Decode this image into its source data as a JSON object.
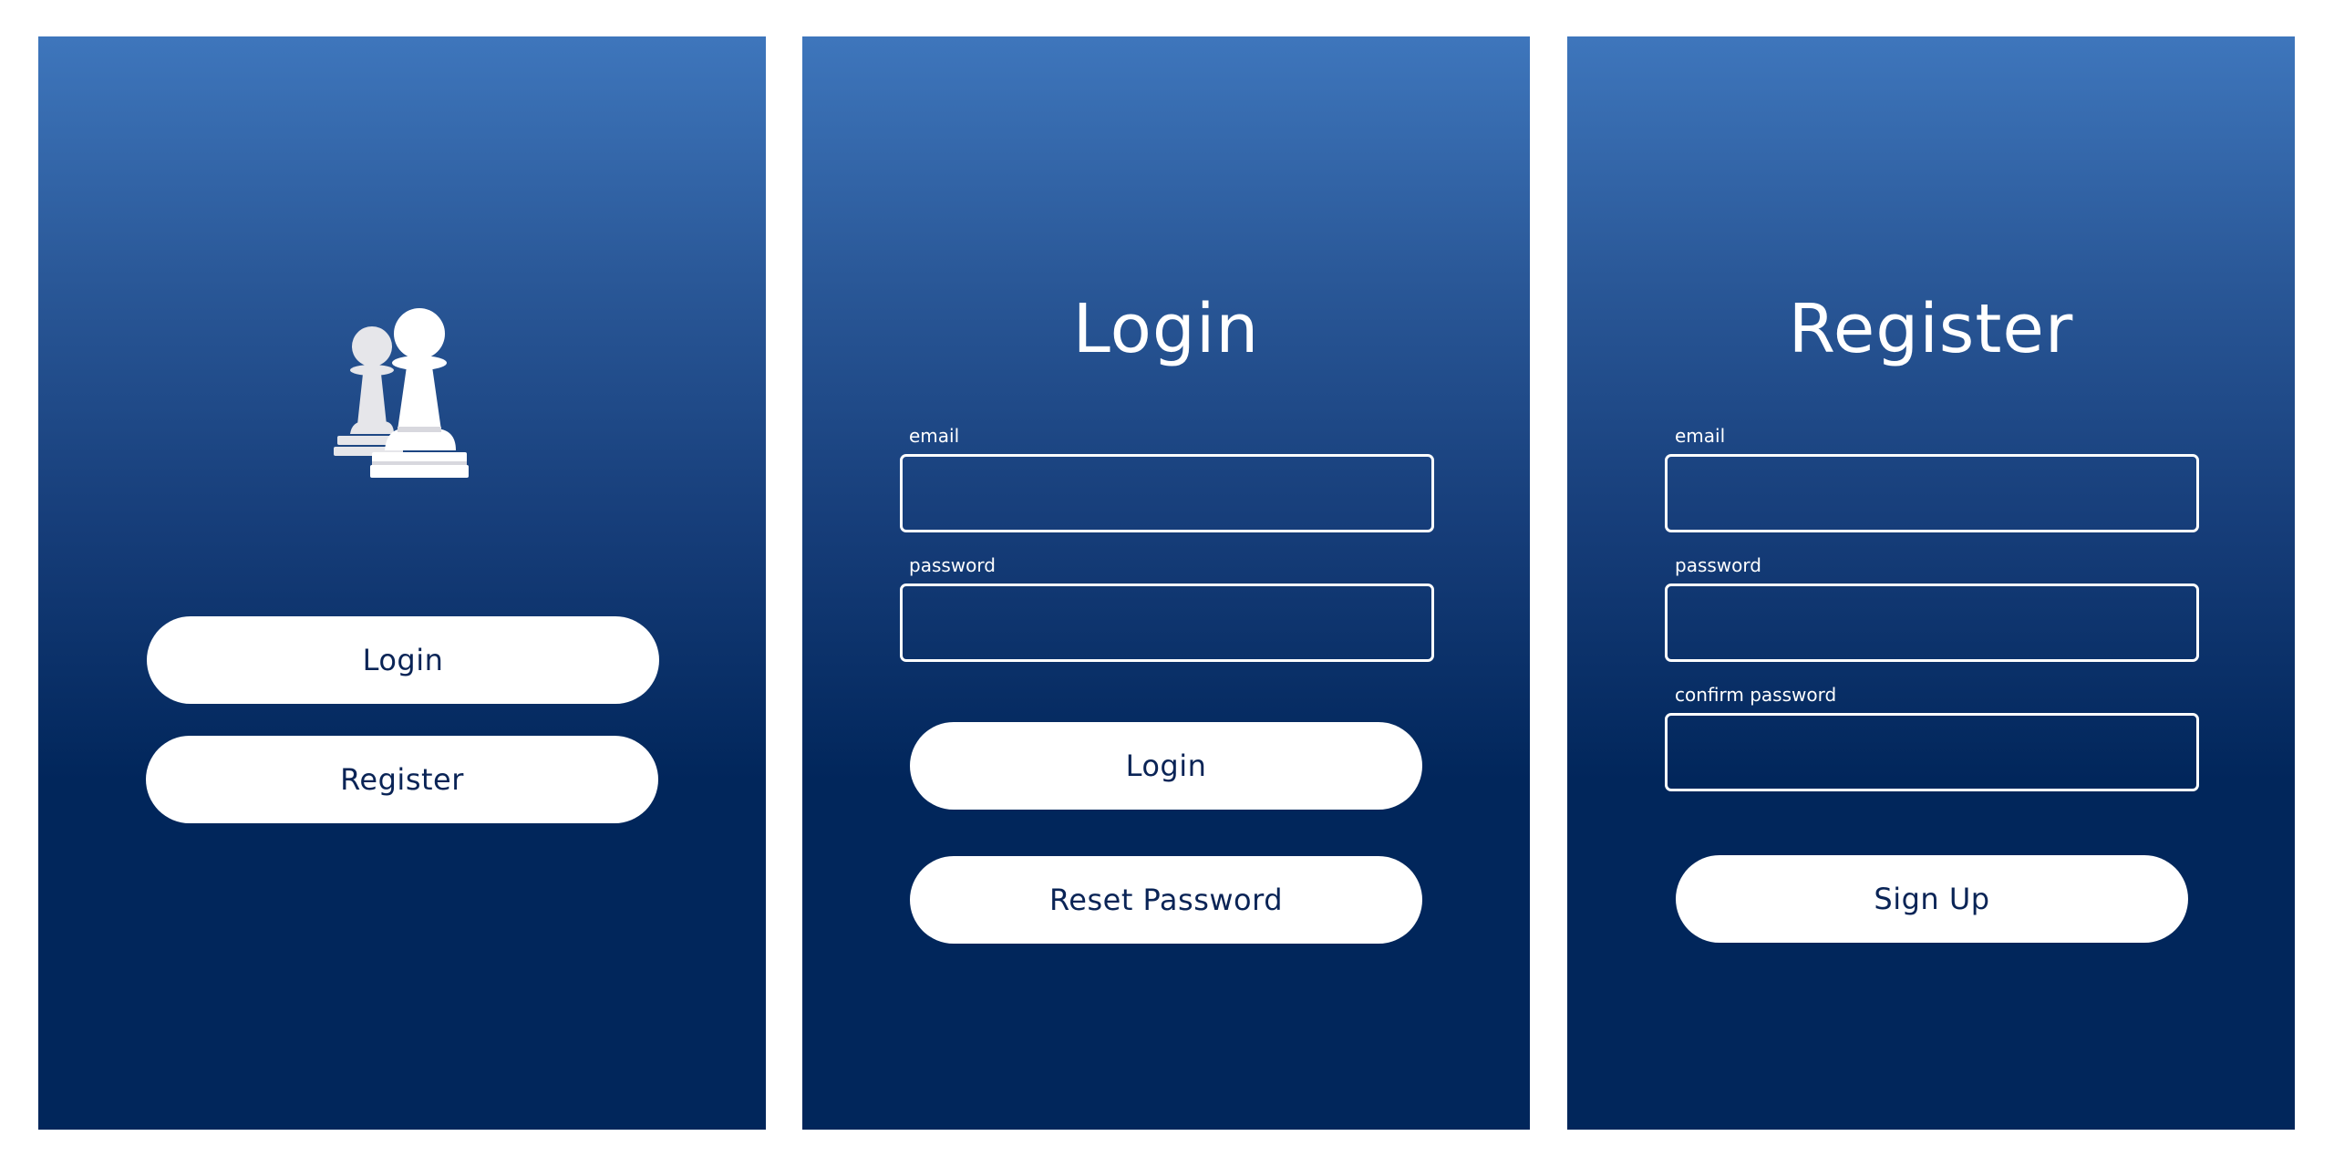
{
  "welcome": {
    "logo_icon": "chess-pawns-icon",
    "login_label": "Login",
    "register_label": "Register"
  },
  "login": {
    "title": "Login",
    "email_label": "email",
    "email_value": "",
    "password_label": "password",
    "password_value": "",
    "login_button": "Login",
    "reset_button": "Reset Password"
  },
  "register": {
    "title": "Register",
    "email_label": "email",
    "email_value": "",
    "password_label": "password",
    "password_value": "",
    "confirm_label": "confirm password",
    "confirm_value": "",
    "signup_button": "Sign Up"
  },
  "colors": {
    "gradient_top": "#3e76bc",
    "gradient_bottom": "#01265b",
    "button_text": "#0a2456"
  }
}
